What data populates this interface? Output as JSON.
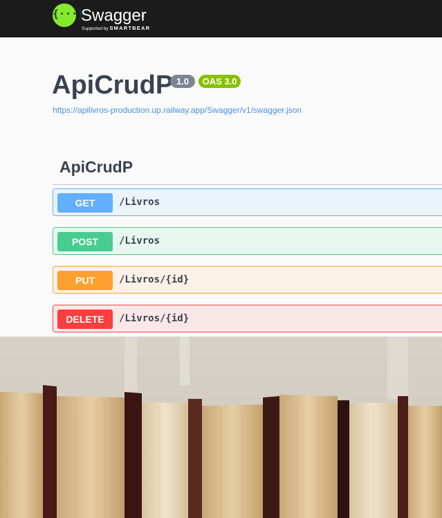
{
  "header": {
    "brand_icon": "{···}",
    "brand_name": "Swagger",
    "brand_tm": "™",
    "supported_by": "Supported by",
    "supported_by_company": "SMARTBEAR"
  },
  "info": {
    "title": "ApiCrudP",
    "version": "1.0",
    "oas_version": "OAS 3.0",
    "spec_url": "https://apilivros-production.up.railway.app/Swagger/v1/swagger.json"
  },
  "tag": {
    "name": "ApiCrudP"
  },
  "operations": [
    {
      "method": "GET",
      "path": "/Livros",
      "color": "#61affe"
    },
    {
      "method": "POST",
      "path": "/Livros",
      "color": "#49cc90"
    },
    {
      "method": "PUT",
      "path": "/Livros/{id}",
      "color": "#fca130"
    },
    {
      "method": "DELETE",
      "path": "/Livros/{id}",
      "color": "#f93e3e"
    }
  ],
  "colors": {
    "topbar": "#1b1b1b",
    "logo_green": "#85ea2d",
    "link": "#4990e2",
    "title": "#3b4151"
  }
}
